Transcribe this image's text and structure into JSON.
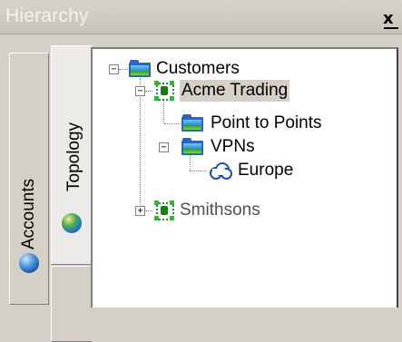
{
  "window": {
    "title": "Hierarchy",
    "close_glyph": "x"
  },
  "tabs": [
    {
      "label": "Accounts",
      "icon": "globe-icon"
    },
    {
      "label": "Topology",
      "icon": "globe-icon"
    }
  ],
  "tree": {
    "root": {
      "label": "Customers",
      "icon": "folder-icon",
      "expanded": true
    },
    "acme": {
      "label": "Acme Trading",
      "icon": "customer-icon",
      "expanded": true,
      "selected": true
    },
    "p2p": {
      "label": "Point to Points",
      "icon": "folder-icon"
    },
    "vpns": {
      "label": "VPNs",
      "icon": "folder-icon",
      "expanded": true
    },
    "europe": {
      "label": "Europe",
      "icon": "cloud-icon"
    },
    "smithsons": {
      "label": "Smithsons",
      "icon": "customer-icon",
      "expanded": false
    }
  },
  "toggle": {
    "expanded": "−",
    "collapsed": "+"
  },
  "colors": {
    "panel_bg": "#d4d0c8",
    "selection_bg": "#d4d0c8",
    "folder_blue": "#2b66b8",
    "customer_green": "#2e8b2e"
  }
}
